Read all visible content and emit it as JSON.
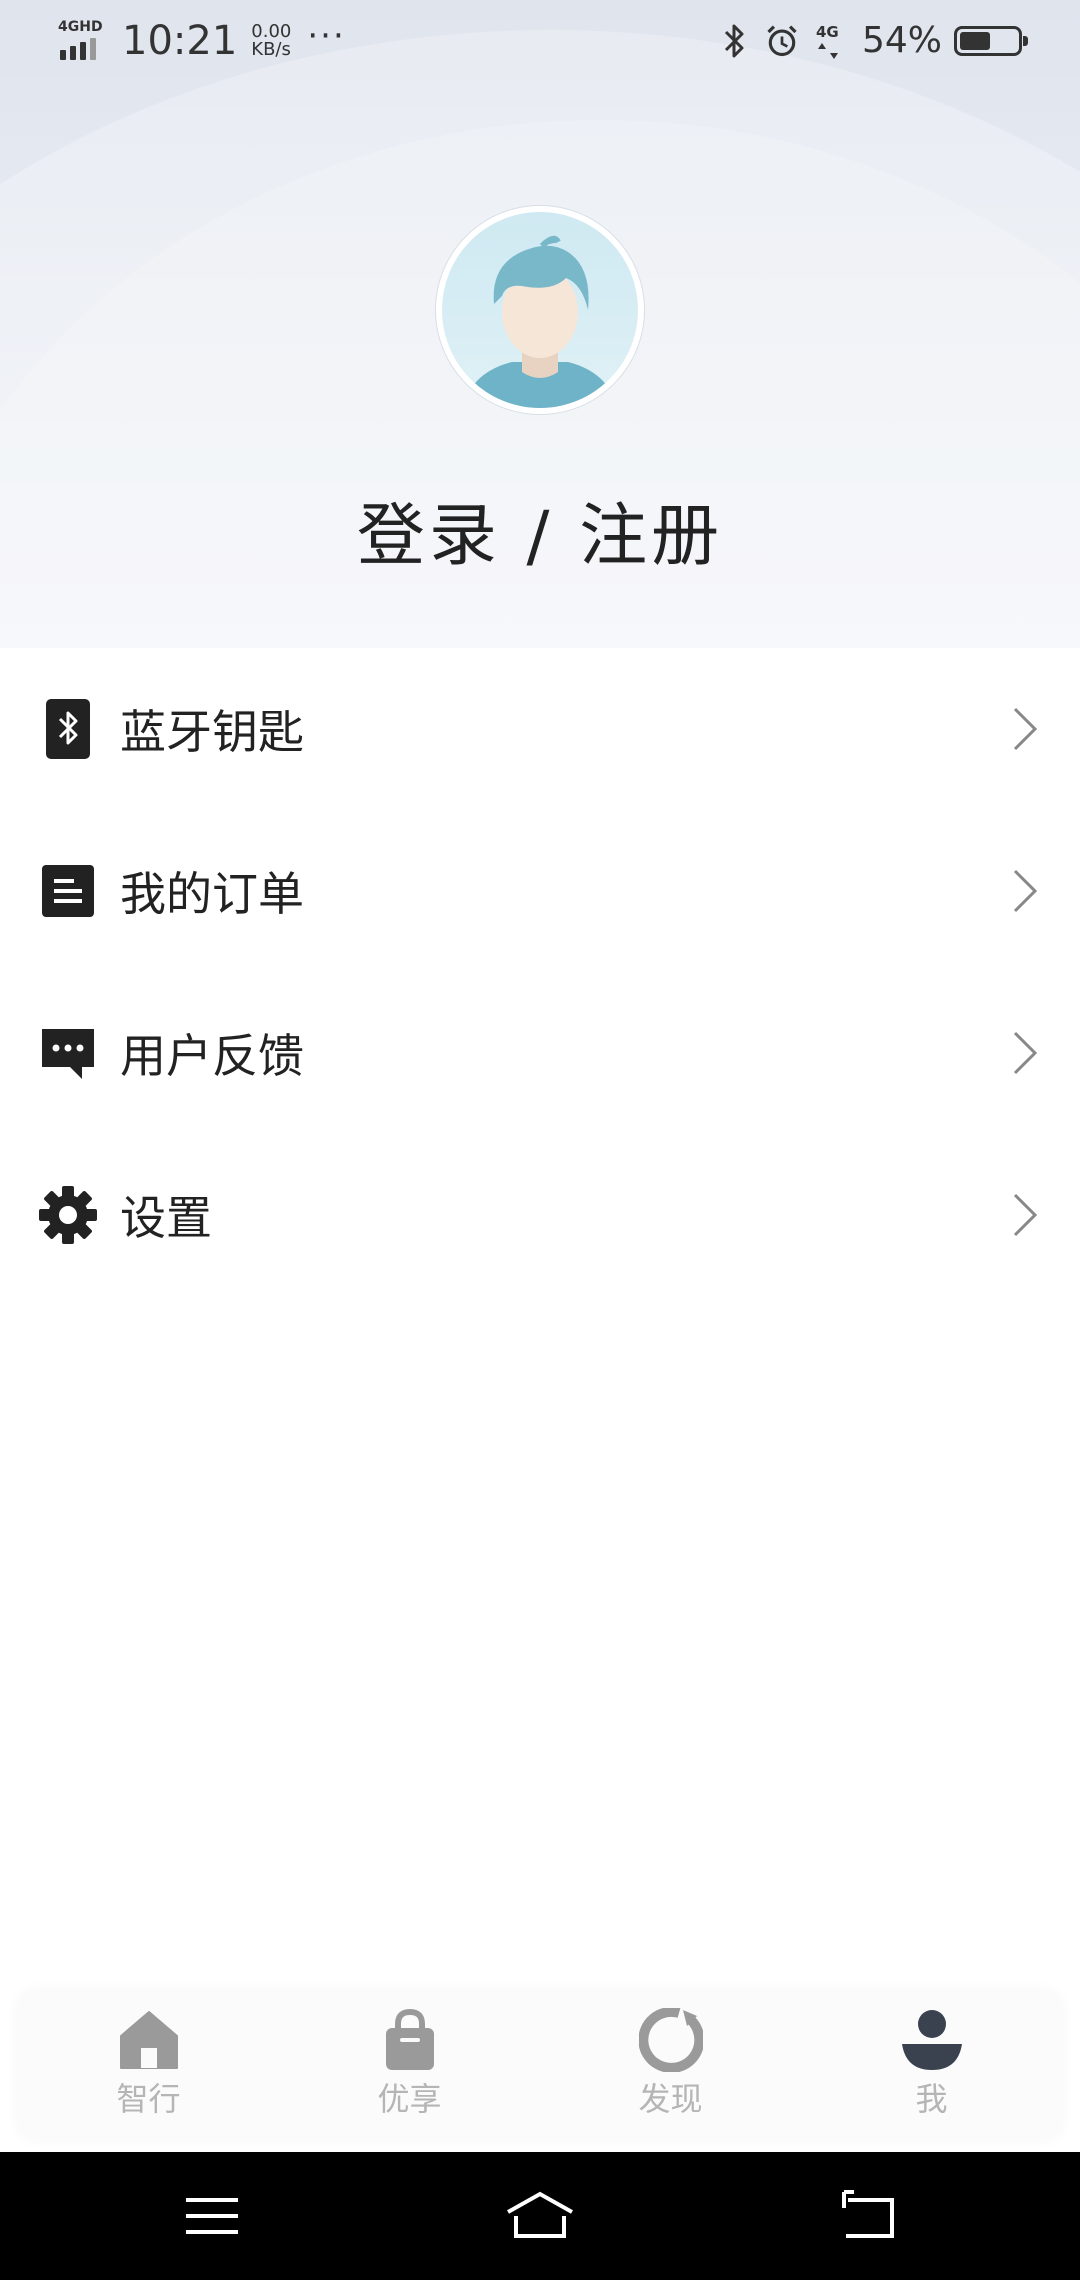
{
  "status_bar": {
    "network": "4GHD",
    "time": "10:21",
    "speed_value": "0.00",
    "speed_unit": "KB/s",
    "more": "···",
    "mobile_data": "4G",
    "battery_text": "54%",
    "battery_level": 0.54
  },
  "header": {
    "login_label": "登录 / 注册"
  },
  "menu": {
    "items": [
      {
        "label": "蓝牙钥匙",
        "icon": "bluetooth-key-icon"
      },
      {
        "label": "我的订单",
        "icon": "order-list-icon"
      },
      {
        "label": "用户反馈",
        "icon": "feedback-chat-icon"
      },
      {
        "label": "设置",
        "icon": "gear-icon"
      }
    ]
  },
  "tabbar": {
    "tabs": [
      {
        "label": "智行",
        "icon": "home-icon"
      },
      {
        "label": "优享",
        "icon": "shopping-bag-icon"
      },
      {
        "label": "发现",
        "icon": "discover-icon"
      },
      {
        "label": "我",
        "icon": "profile-icon",
        "active": true
      }
    ]
  },
  "colors": {
    "header_bg": "#e3e8f0",
    "tab_inactive": "#9a9a9a",
    "tab_active": "#3a4250",
    "text_primary": "#222222"
  }
}
